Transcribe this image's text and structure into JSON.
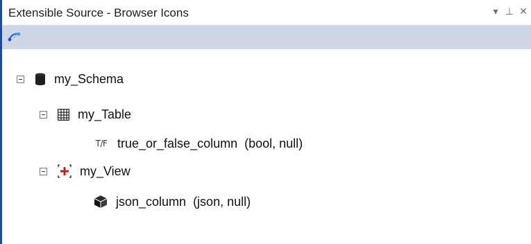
{
  "panel": {
    "title": "Extensible Source - Browser Icons",
    "controls": {
      "dropdown": "▾",
      "pin": "⊥",
      "close": "✕"
    }
  },
  "toolbar": {
    "icon": "connect-icon"
  },
  "tree": {
    "schema": {
      "label": "my_Schema",
      "icon": "database-icon"
    },
    "table": {
      "label": "my_Table",
      "icon": "table-grid-icon"
    },
    "bool_column": {
      "type_glyph": "T/F",
      "label": "true_or_false_column",
      "meta": "(bool, null)"
    },
    "view": {
      "label": "my_View",
      "icon": "view-icon"
    },
    "json_column": {
      "label": "json_column",
      "meta": "(json, null)",
      "icon": "cube-icon"
    }
  }
}
